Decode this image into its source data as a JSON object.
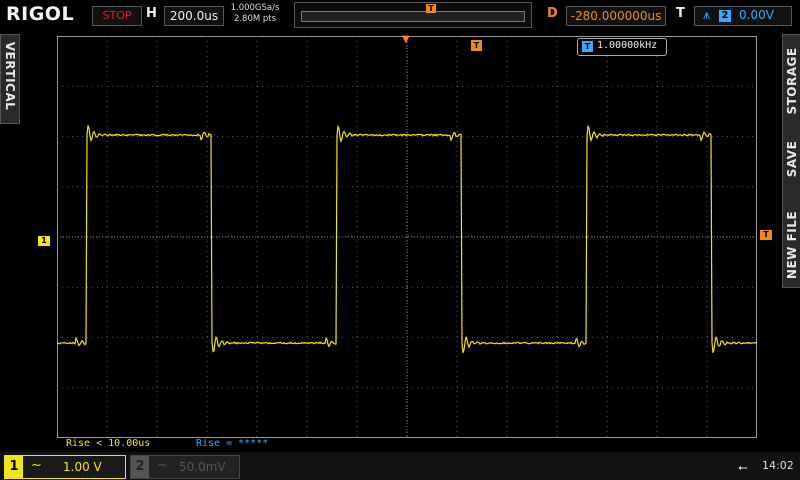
{
  "header": {
    "logo": "RIGOL",
    "run_status": "STOP",
    "h_label": "H",
    "timebase": "200.0us",
    "sample_rate": "1.000GSa/s",
    "mem_depth": "2.80M pts",
    "d_label": "D",
    "delay": "-280.000000us",
    "t_label": "T",
    "trigger_source": "2",
    "trigger_level": "0.00V",
    "trigger_marker": "T"
  },
  "side": {
    "left_tab": "VERTICAL",
    "right_tabs": [
      "STORAGE",
      "SAVE",
      "NEW FILE"
    ]
  },
  "screen": {
    "freq_icon": "T",
    "frequency": "1.00000kHz",
    "ch1_marker": "1",
    "trig_level_marker": "T",
    "trig_pos_marker": "T"
  },
  "measurements": {
    "m1": "Rise < 10.00us",
    "m2": "Rise = *****"
  },
  "footer": {
    "ch1_num": "1",
    "ch1_coupling": "~",
    "ch1_scale": "1.00 V",
    "ch2_num": "2",
    "ch2_coupling": "~",
    "ch2_scale": "50.0mV",
    "clock": "14:02"
  },
  "colors": {
    "ch1": "#f2e41a",
    "trigger": "#f18a1a",
    "accent": "#3ba8ff",
    "stop": "#e0201c"
  },
  "icons": {
    "usb": "usb-icon",
    "slope": "rising-edge-icon"
  }
}
